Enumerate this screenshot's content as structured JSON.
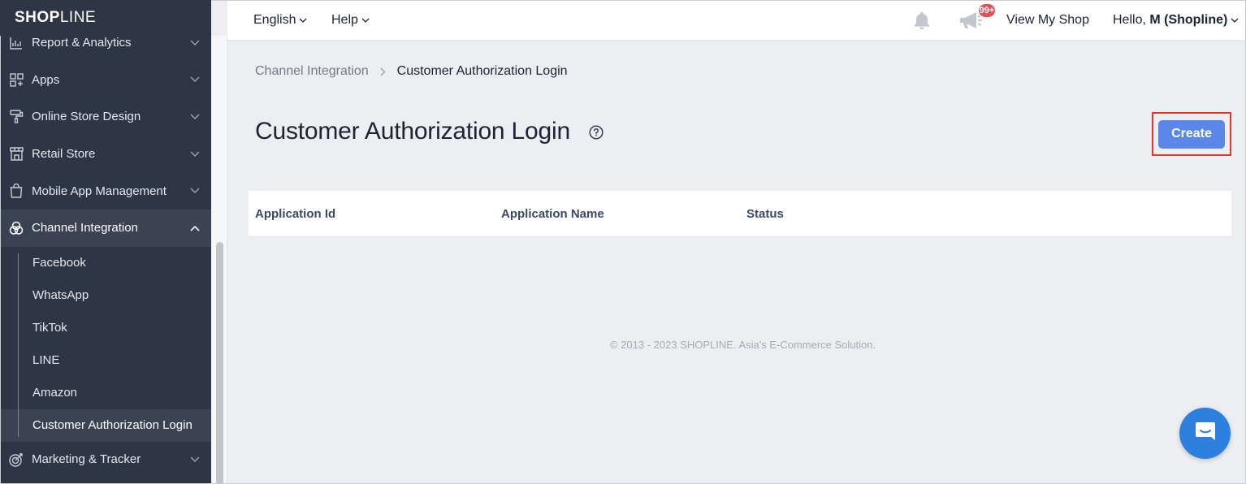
{
  "sidebar": {
    "logo_bold": "SHOP",
    "logo_thin": "LINE",
    "items": [
      {
        "label": "Report & Analytics",
        "icon": "chart-icon"
      },
      {
        "label": "Apps",
        "icon": "apps-grid-icon"
      },
      {
        "label": "Online Store Design",
        "icon": "paint-roller-icon"
      },
      {
        "label": "Retail Store",
        "icon": "storefront-icon"
      },
      {
        "label": "Mobile App Management",
        "icon": "shopping-bag-icon"
      },
      {
        "label": "Channel Integration",
        "icon": "channel-circles-icon"
      },
      {
        "label": "Marketing & Tracker",
        "icon": "target-icon"
      }
    ],
    "channel_sub_items": [
      "Facebook",
      "WhatsApp",
      "TikTok",
      "LINE",
      "Amazon",
      "Customer Authorization Login"
    ]
  },
  "topbar": {
    "language": "English",
    "help": "Help",
    "notification_badge": "99+",
    "view_shop": "View My Shop",
    "greeting": "Hello,",
    "user": "M (Shopline)"
  },
  "breadcrumb": {
    "parent": "Channel Integration",
    "current": "Customer Authorization Login"
  },
  "page": {
    "title": "Customer Authorization Login",
    "create_label": "Create"
  },
  "table": {
    "columns": [
      "Application Id",
      "Application Name",
      "Status"
    ],
    "rows": []
  },
  "footer": "© 2013 - 2023 SHOPLINE. Asia's E-Commerce Solution.",
  "colors": {
    "sidebar_bg": "#2e3646",
    "primary_button": "#5a87e8",
    "highlight_border": "#e0392b",
    "badge": "#e4505a",
    "chat_button": "#2d7fe0"
  }
}
